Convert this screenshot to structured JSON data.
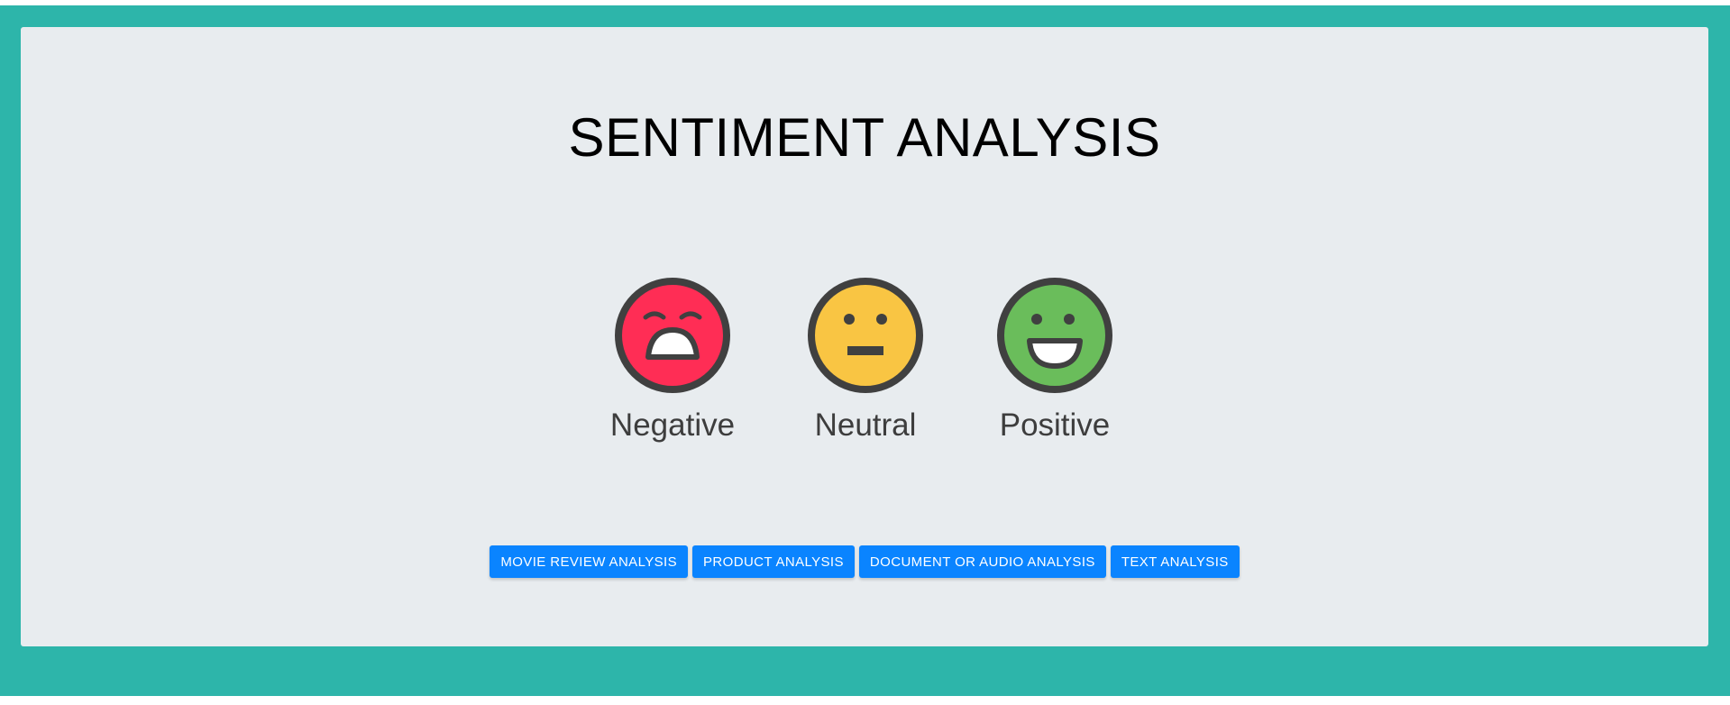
{
  "header": {
    "title": "SENTIMENT ANALYSIS"
  },
  "sentiments": [
    {
      "label": "Negative",
      "icon": "sad-face-icon",
      "color": "#ff2d55"
    },
    {
      "label": "Neutral",
      "icon": "neutral-face-icon",
      "color": "#f9c543"
    },
    {
      "label": "Positive",
      "icon": "happy-face-icon",
      "color": "#6abd5b"
    }
  ],
  "actions": {
    "movie_review": "MOVIE REVIEW ANALYSIS",
    "product": "PRODUCT ANALYSIS",
    "document_audio": "DOCUMENT OR AUDIO ANALYSIS",
    "text": "TEXT ANALYSIS"
  },
  "colors": {
    "frame": "#2db5aa",
    "panel": "#e8ecef",
    "button": "#0a84ff",
    "face_outline": "#404040"
  }
}
